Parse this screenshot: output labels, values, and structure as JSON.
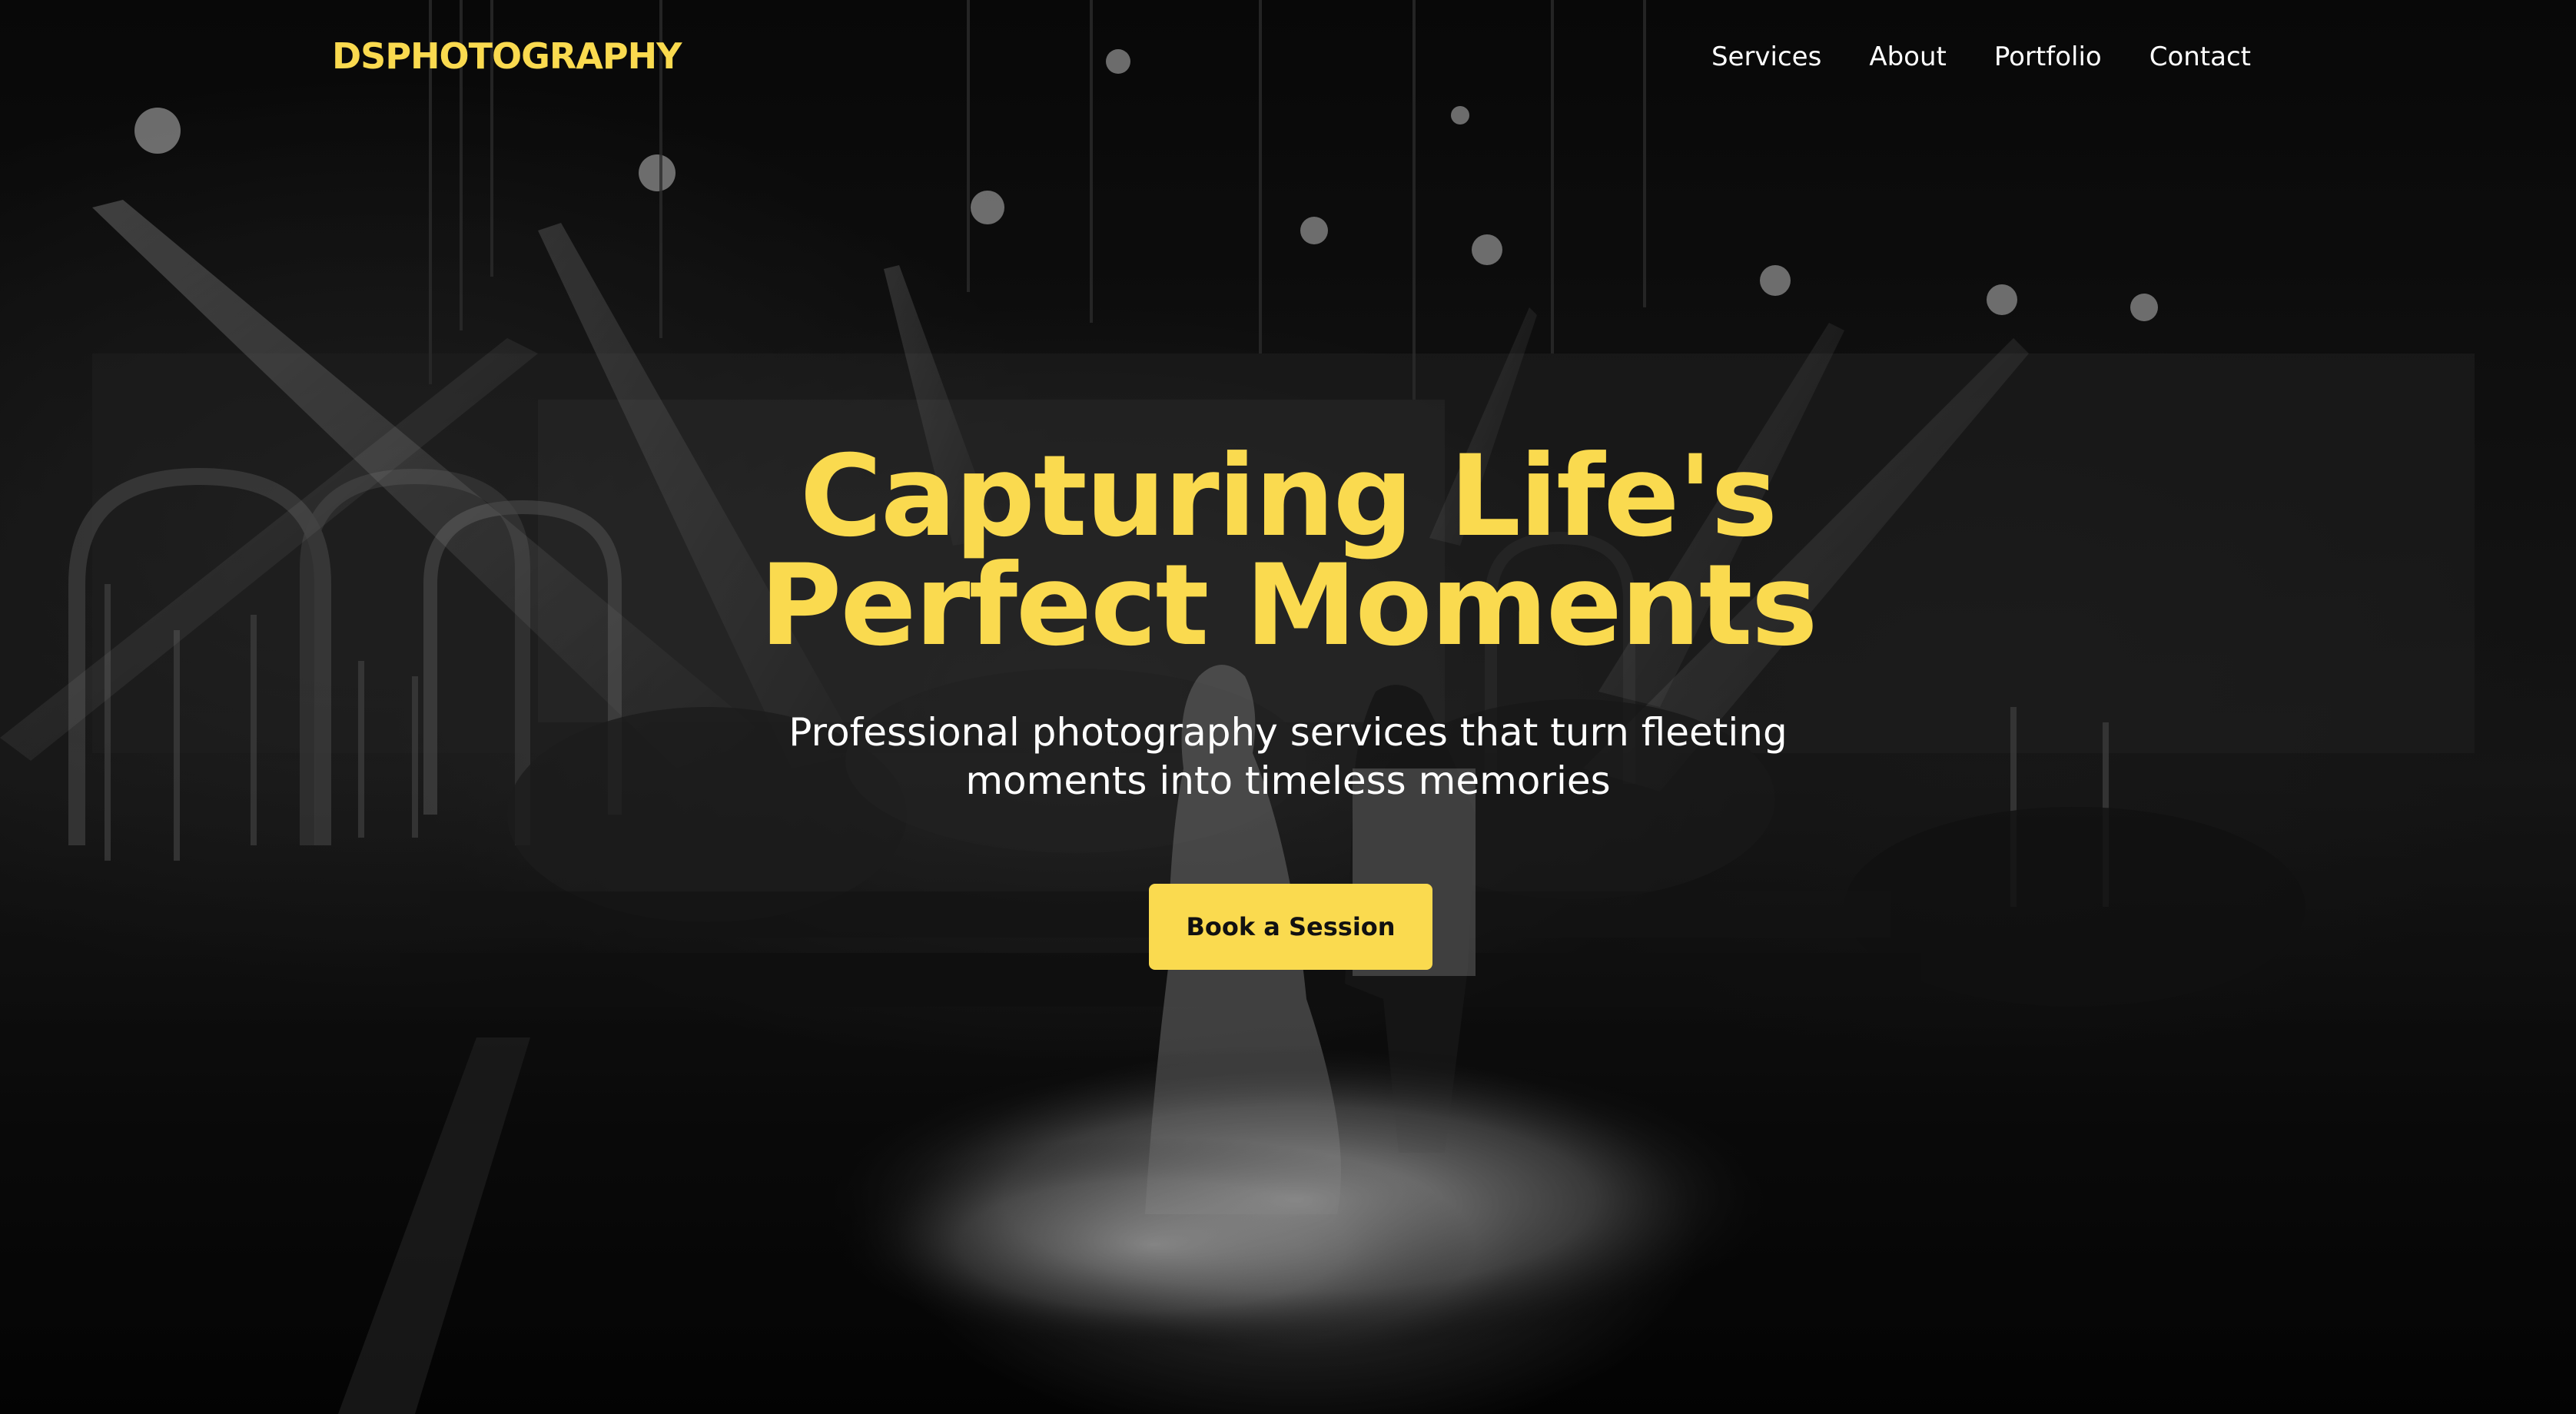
{
  "brand": {
    "name": "DSPHOTOGRAPHY"
  },
  "nav": {
    "items": [
      {
        "label": "Services"
      },
      {
        "label": "About"
      },
      {
        "label": "Portfolio"
      },
      {
        "label": "Contact"
      }
    ]
  },
  "hero": {
    "headline_line1": "Capturing Life's",
    "headline_line2": "Perfect Moments",
    "subtitle_line1": "Professional photography services that turn fleeting",
    "subtitle_line2": "moments into timeless memories",
    "cta_label": "Book a Session",
    "background": "black-and-white-wedding-stage-photo"
  },
  "colors": {
    "accent": "#FADA4F",
    "text": "#FFFFFF",
    "background": "#000000"
  }
}
